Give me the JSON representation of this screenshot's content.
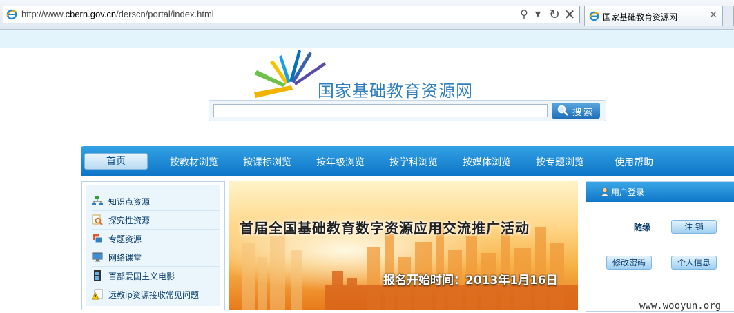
{
  "browser": {
    "url_prefix": "http://www.",
    "url_domain": "cbern.gov.cn",
    "url_suffix": "/derscn/portal/index.html",
    "tab_title": "国家基础教育资源网"
  },
  "site": {
    "title": "国家基础教育资源网"
  },
  "search": {
    "value": "",
    "button_label": "搜索"
  },
  "nav": {
    "home": "首页",
    "items": [
      "按教材浏览",
      "按课标浏览",
      "按年级浏览",
      "按学科浏览",
      "按媒体浏览",
      "按专题浏览",
      "使用帮助"
    ]
  },
  "sidebar": {
    "items": [
      {
        "label": "知识点资源",
        "icon": "network-icon"
      },
      {
        "label": "探究性资源",
        "icon": "magnifier-doc-icon"
      },
      {
        "label": "专题资源",
        "icon": "windows-icon"
      },
      {
        "label": "网络课堂",
        "icon": "monitor-icon"
      },
      {
        "label": "百部爱国主义电影",
        "icon": "film-icon"
      },
      {
        "label": "远教ip资源接收常见问题",
        "icon": "warning-doc-icon"
      }
    ]
  },
  "banner": {
    "headline": "首届全国基础教育数字资源应用交流推广活动",
    "date_text": "报名开始时间：2013年1月16日"
  },
  "login": {
    "title": "用户登录",
    "username": "随缘",
    "logout": "注 销",
    "change_password": "修改密码",
    "profile": "个人信息"
  },
  "watermark": "www.wooyun.org"
}
